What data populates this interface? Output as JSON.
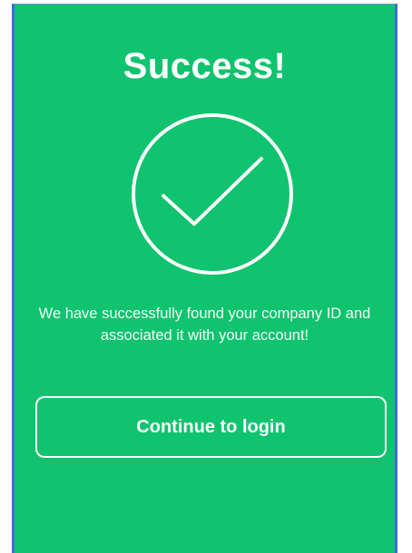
{
  "screen": {
    "title": "Success!",
    "message": "We have successfully found your company ID and associated it with your account!",
    "continue_button_label": "Continue to login"
  },
  "icons": {
    "status_icon": "check-circle-icon"
  },
  "colors": {
    "background": "#10c36e",
    "foreground": "#ffffff",
    "frame_border": "#3d6fd6"
  }
}
